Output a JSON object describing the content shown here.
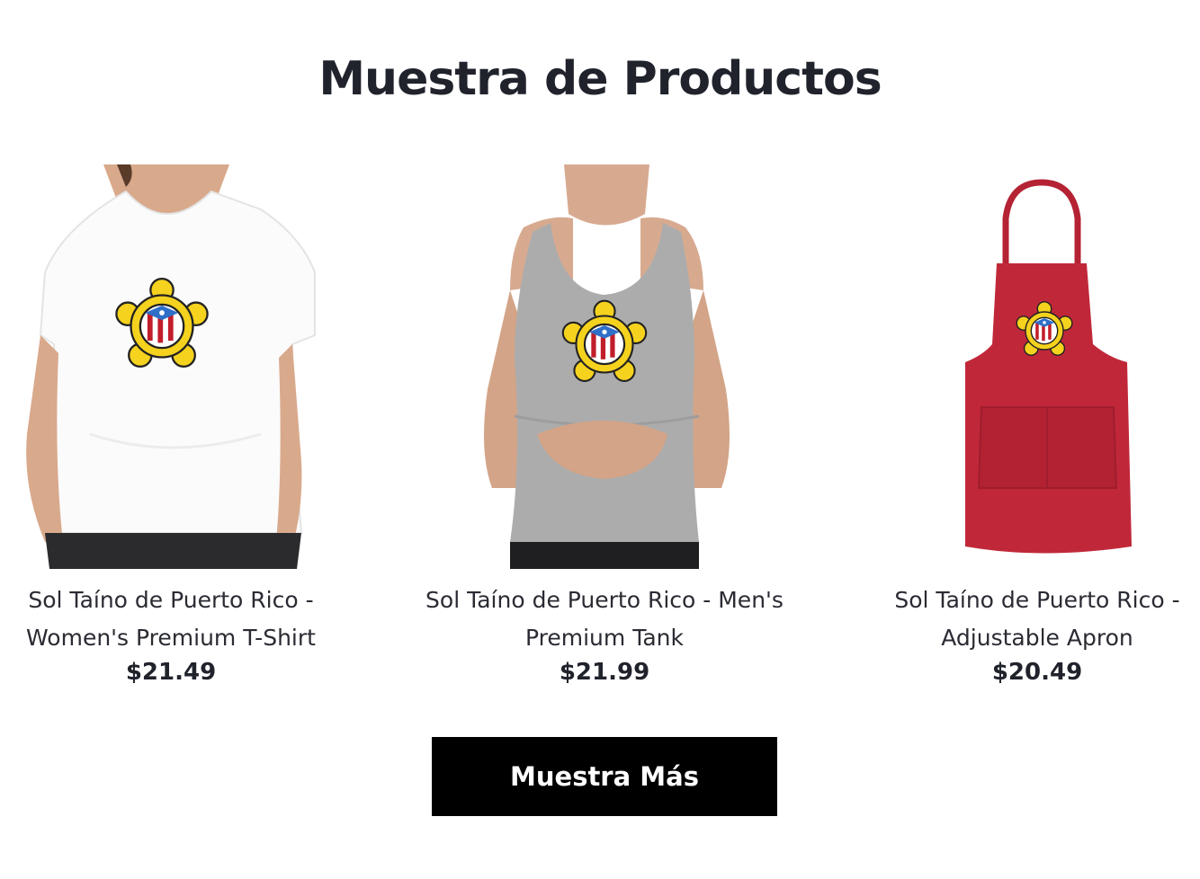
{
  "section": {
    "title": "Muestra de Productos"
  },
  "products": [
    {
      "name": "Sol Taíno de Puerto Rico - Women's Premium T-Shirt",
      "price": "$21.49",
      "image_icon": "womens-tshirt-image"
    },
    {
      "name": "Sol Taíno de Puerto Rico - Men's Premium Tank",
      "price": "$21.99",
      "image_icon": "mens-tank-image"
    },
    {
      "name": "Sol Taíno de Puerto Rico - Adjustable Apron",
      "price": "$20.49",
      "image_icon": "apron-image"
    }
  ],
  "more_button": {
    "label": "Muestra Más"
  },
  "colors": {
    "button_bg": "#000000",
    "title": "#20232c",
    "tshirt": "#ffffff",
    "tank": "#a9a9a9",
    "apron": "#c0283a"
  }
}
